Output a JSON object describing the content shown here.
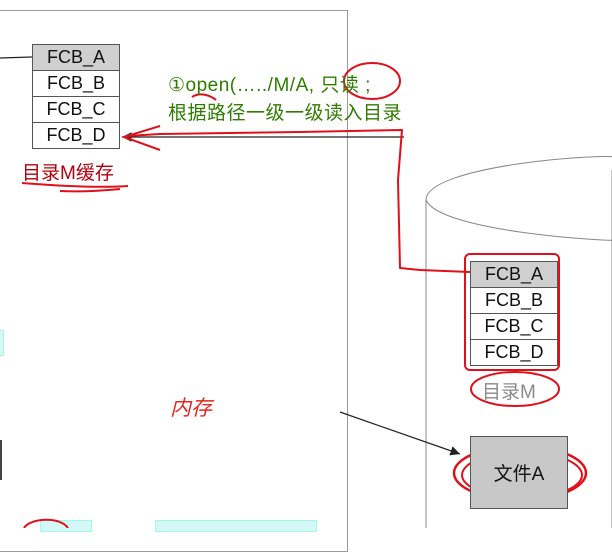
{
  "memory_dir_cache": {
    "entries": [
      "FCB_A",
      "FCB_B",
      "FCB_C",
      "FCB_D"
    ],
    "caption": "目录M缓存"
  },
  "annotation": {
    "line1_prefix": "①open(…../M/A,",
    "line1_readonly": "只读",
    "line1_suffix": ";",
    "line2": "根据路径一级一级读入目录"
  },
  "memory_label": "内存",
  "disk_dir": {
    "entries": [
      "FCB_A",
      "FCB_B",
      "FCB_C",
      "FCB_D"
    ],
    "caption": "目录M"
  },
  "file_a_label": "文件A",
  "colors": {
    "annotation_red": "#e0101a",
    "caption_red": "#b0000e",
    "note_green": "#2f7d00",
    "highlight_gray": "#cfcfcf"
  }
}
